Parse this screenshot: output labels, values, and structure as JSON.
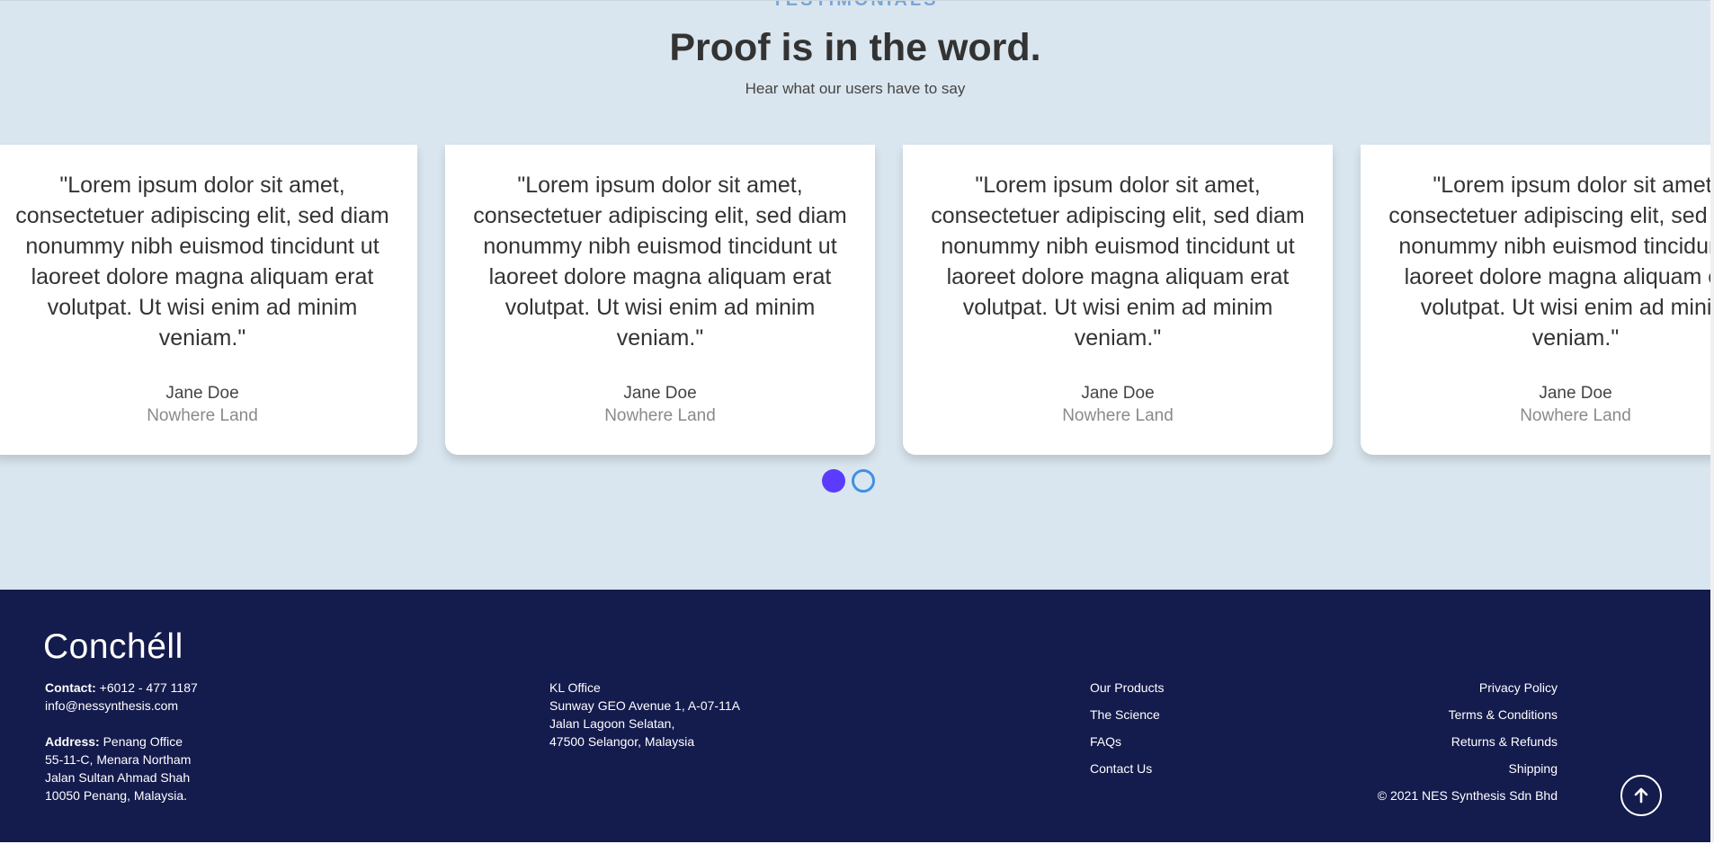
{
  "testimonials": {
    "eyebrow": "TESTIMONIALS",
    "heading": "Proof is in the word.",
    "subheading": "Hear what our users have to say",
    "cards": [
      {
        "quote": "\"Lorem ipsum dolor sit amet, consectetuer adipiscing elit, sed diam nonummy nibh euismod tincidunt ut laoreet dolore magna aliquam erat volutpat. Ut wisi enim ad minim veniam.\"",
        "author": "Jane Doe",
        "place": "Nowhere Land"
      },
      {
        "quote": "\"Lorem ipsum dolor sit amet, consectetuer adipiscing elit, sed diam nonummy nibh euismod tincidunt ut laoreet dolore magna aliquam erat volutpat. Ut wisi enim ad minim veniam.\"",
        "author": "Jane Doe",
        "place": "Nowhere Land"
      },
      {
        "quote": "\"Lorem ipsum dolor sit amet, consectetuer adipiscing elit, sed diam nonummy nibh euismod tincidunt ut laoreet dolore magna aliquam erat volutpat. Ut wisi enim ad minim veniam.\"",
        "author": "Jane Doe",
        "place": "Nowhere Land"
      },
      {
        "quote": "\"Lorem ipsum dolor sit amet, consectetuer adipiscing elit, sed diam nonummy nibh euismod tincidunt ut laoreet dolore magna aliquam erat volutpat. Ut wisi enim ad minim veniam.\"",
        "author": "Jane Doe",
        "place": "Nowhere Land"
      }
    ],
    "pagination": {
      "total": 2,
      "active": 1
    }
  },
  "footer": {
    "logo": "Conchéll",
    "contact_label": "Contact:",
    "contact_phone": "+6012 - 477 1187",
    "contact_email": "info@nessynthesis.com",
    "address_label": "Address:",
    "address_office": "Penang Office",
    "address_lines": [
      "55-11-C, Menara Northam",
      "Jalan Sultan Ahmad Shah",
      "10050 Penang, Malaysia."
    ],
    "kl_office": {
      "title": "KL Office",
      "lines": [
        "Sunway GEO Avenue 1, A-07-11A",
        "Jalan Lagoon Selatan,",
        "47500 Selangor, Malaysia"
      ]
    },
    "nav_links": [
      "Our Products",
      "The Science",
      "FAQs",
      "Contact Us"
    ],
    "policy_links": [
      "Privacy Policy",
      "Terms & Conditions",
      "Returns & Refunds",
      "Shipping"
    ],
    "copyright": "© 2021 NES Synthesis Sdn Bhd",
    "scroll_top_icon": "arrow-up-icon"
  },
  "colors": {
    "section_bg": "#dae6ef",
    "footer_bg": "#141b4d",
    "dot_active": "#5b3cff",
    "dot_inactive_border": "#3f8fe6"
  }
}
